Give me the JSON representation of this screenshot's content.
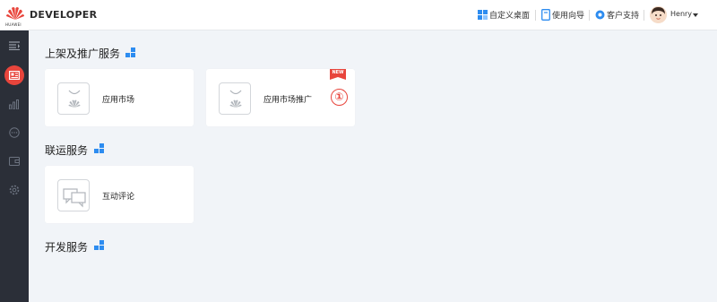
{
  "header": {
    "logo_text": "HUAWEI",
    "brand": "DEVELOPER",
    "links": [
      {
        "label": "自定义桌面",
        "icon": "grid-icon"
      },
      {
        "label": "使用向导",
        "icon": "guide-book-icon"
      },
      {
        "label": "客户支持",
        "icon": "support-icon"
      }
    ],
    "user_name": "Henry"
  },
  "sidebar": {
    "items": [
      {
        "icon": "menu-collapse-icon",
        "active": false
      },
      {
        "icon": "app-card-icon",
        "active": true
      },
      {
        "icon": "bar-chart-icon",
        "active": false
      },
      {
        "icon": "chat-bubble-icon",
        "active": false
      },
      {
        "icon": "wallet-icon",
        "active": false
      },
      {
        "icon": "settings-gear-icon",
        "active": false
      }
    ]
  },
  "sections": [
    {
      "title": "上架及推广服务",
      "cards": [
        {
          "label": "应用市场",
          "icon": "huawei-bag-icon"
        },
        {
          "label": "应用市场推广",
          "icon": "huawei-bag-icon",
          "badge": "NEW",
          "marker": "①"
        }
      ]
    },
    {
      "title": "联运服务",
      "cards": [
        {
          "label": "互动评论",
          "icon": "comment-bubbles-icon"
        }
      ]
    },
    {
      "title": "开发服务",
      "cards": []
    }
  ],
  "colors": {
    "accent_red": "#e8453c",
    "accent_blue": "#2d8cf0",
    "sidebar_bg": "#2b2f38",
    "page_bg": "#f1f4f8"
  }
}
